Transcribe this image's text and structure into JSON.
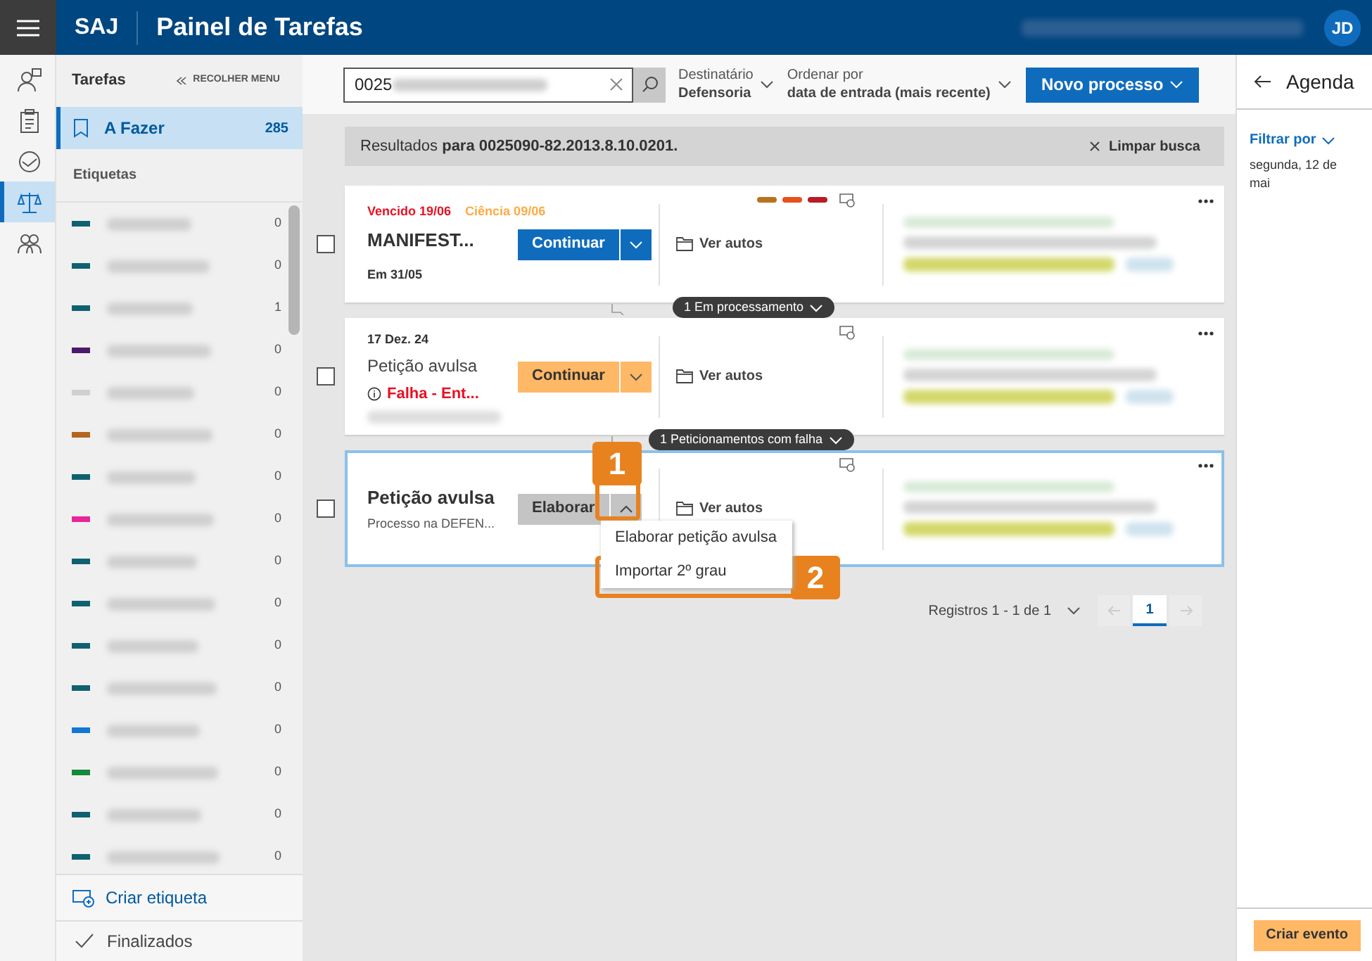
{
  "header": {
    "app": "SAJ",
    "title": "Painel de Tarefas",
    "avatar": "JD"
  },
  "rail": [
    {
      "selected": false
    },
    {
      "selected": false
    },
    {
      "selected": false
    },
    {
      "selected": true
    },
    {
      "selected": false
    }
  ],
  "sidebar": {
    "title": "Tarefas",
    "collapse": "RECOLHER MENU",
    "todo": {
      "label": "A Fazer",
      "count": "285",
      "selected": true
    },
    "tags_title": "Etiquetas",
    "tags": [
      {
        "color": "#106170",
        "count": "0"
      },
      {
        "color": "#106170",
        "count": "0"
      },
      {
        "color": "#106170",
        "count": "1"
      },
      {
        "color": "#4b1a6b",
        "count": "0"
      },
      {
        "color": "#d0d0d0",
        "count": "0"
      },
      {
        "color": "#b5651d",
        "count": "0"
      },
      {
        "color": "#106170",
        "count": "0"
      },
      {
        "color": "#e8259a",
        "count": "0"
      },
      {
        "color": "#106170",
        "count": "0"
      },
      {
        "color": "#106170",
        "count": "0"
      },
      {
        "color": "#106170",
        "count": "0"
      },
      {
        "color": "#106170",
        "count": "0"
      },
      {
        "color": "#0f78d4",
        "count": "0"
      },
      {
        "color": "#128a3a",
        "count": "0"
      },
      {
        "color": "#106170",
        "count": "0"
      },
      {
        "color": "#106170",
        "count": "0"
      }
    ],
    "create": "Criar etiqueta",
    "done": "Finalizados"
  },
  "toolbar": {
    "search": "0025",
    "recipient_label": "Destinatário",
    "recipient": "Defensoria",
    "sort_label": "Ordenar por",
    "sort": "data de entrada (mais recente)",
    "new": "Novo processo"
  },
  "results": {
    "text": "Resultados **para 0025090-82.2013.8.10.0201.**",
    "clear": "Limpar busca"
  },
  "cards": [
    {
      "kind": "overdue",
      "selected": false,
      "checked": false,
      "due": "Vencido 19/06",
      "notice": "Ciência 09/06",
      "title": "MANIFEST...",
      "subtitle": "Em 31/05",
      "action": "Continuar",
      "expanded": false,
      "tags": [
        {
          "color": "#b8731e"
        },
        {
          "color": "#e8501e"
        },
        {
          "color": "#b81c25"
        }
      ],
      "view": "Ver autos",
      "badge": "1 Em processamento"
    },
    {
      "kind": "failed",
      "selected": false,
      "checked": false,
      "date": "17 Dez. 24",
      "title": "Petição avulsa",
      "error": "Falha - Ent...",
      "action": "Continuar",
      "expanded": false,
      "view": "Ver autos",
      "badge": "1 Peticionamentos com falha"
    },
    {
      "kind": "draft",
      "selected": true,
      "checked": false,
      "title": "Petição avulsa",
      "subtitle": "Processo na DEFEN...",
      "action": "Elaborar",
      "expanded": true,
      "view": "Ver autos",
      "menu": [
        "Elaborar petição avulsa",
        "Importar 2º grau"
      ]
    }
  ],
  "callouts": [
    "1",
    "2"
  ],
  "pagination": {
    "text": "Registros 1 - 1 de 1",
    "page": "1"
  },
  "agenda": {
    "title": "Agenda",
    "filter": "Filtrar por",
    "date": "segunda, 12 de mai",
    "create": "Criar evento"
  }
}
